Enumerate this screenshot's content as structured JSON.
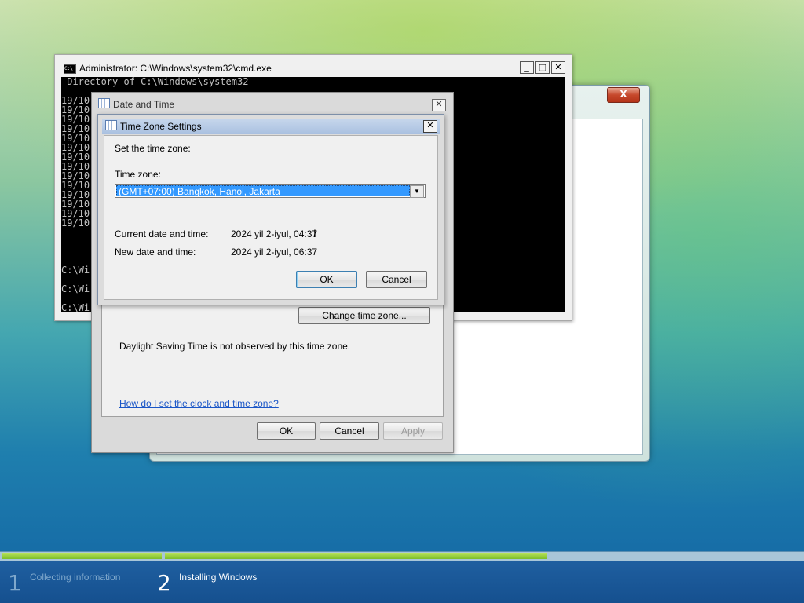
{
  "setup_window": {
    "close_label": "X"
  },
  "cmd_window": {
    "title": "Administrator: C:\\Windows\\system32\\cmd.exe",
    "icon_text": "C:\\",
    "minimize_label": "_",
    "maximize_label": "□",
    "close_label": "✕",
    "lines": [
      " Directory of C:\\Windows\\system32",
      "",
      "19/10",
      "19/10",
      "19/10",
      "19/10",
      "19/10",
      "19/10",
      "19/10",
      "19/10",
      "19/10",
      "19/10",
      "19/10",
      "19/10",
      "19/10",
      "19/10",
      "",
      "",
      "",
      "",
      "C:\\Wi",
      "",
      "C:\\Wi",
      "",
      "C:\\Wi"
    ]
  },
  "date_time_dialog": {
    "title": "Date and Time",
    "close_label": "✕",
    "change_time_zone_button": "Change time zone...",
    "dst_text": "Daylight Saving Time is not observed by this time zone.",
    "help_link": "How do I set the clock and time zone?",
    "ok_button": "OK",
    "cancel_button": "Cancel",
    "apply_button": "Apply"
  },
  "time_zone_dialog": {
    "title": "Time Zone Settings",
    "close_label": "✕",
    "instruction": "Set the time zone:",
    "time_zone_label": "Time zone:",
    "time_zone_selected": "(GMT+07:00) Bangkok, Hanoi, Jakarta",
    "current_label": "Current date and time:",
    "current_value": "2024 yil 2-iyul, 04:37",
    "new_label": "New date and time:",
    "new_value": "2024 yil 2-iyul, 06:37",
    "ok_button": "OK",
    "cancel_button": "Cancel"
  },
  "setup_progress": {
    "steps": [
      {
        "number": "1",
        "label": "Collecting information",
        "state": "done"
      },
      {
        "number": "2",
        "label": "Installing Windows",
        "state": "active"
      }
    ],
    "step1_progress": 1.0,
    "step2_progress": 0.6
  },
  "colors": {
    "selection": "#3399ff",
    "progress_green": "#7dbf2a",
    "link": "#1a56c7"
  }
}
